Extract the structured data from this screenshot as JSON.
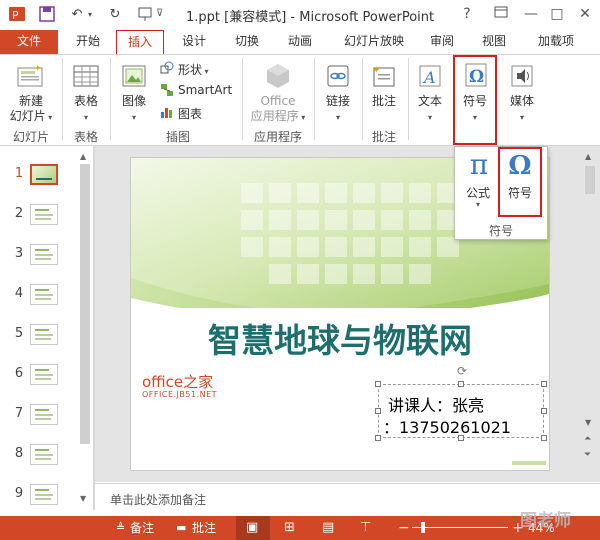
{
  "window": {
    "title": "1.ppt [兼容模式] - Microsoft PowerPoint",
    "help": "?",
    "minimize": "—",
    "maximize": "□",
    "close": "✕"
  },
  "tabs": [
    "文件",
    "开始",
    "插入",
    "设计",
    "切换",
    "动画",
    "幻灯片放映",
    "审阅",
    "视图",
    "加载项"
  ],
  "active_tab": "插入",
  "ribbon": {
    "new_slide": [
      "新建",
      "幻灯片"
    ],
    "table": "表格",
    "image": "图像",
    "shapes": "形状",
    "smartart": "SmartArt",
    "chart": "图表",
    "office_apps": [
      "Office",
      "应用程序"
    ],
    "link": "链接",
    "comment": "批注",
    "text": "文本",
    "symbols": "符号",
    "media": "媒体",
    "groups": {
      "slides": "幻灯片",
      "tables": "表格",
      "illustrations": "插图",
      "apps": "应用程序",
      "comments": "批注"
    }
  },
  "dropdown": {
    "equation": "公式",
    "symbol": "符号",
    "group_title": "符号"
  },
  "slides": {
    "numbers": [
      "1",
      "2",
      "3",
      "4",
      "5",
      "6",
      "7",
      "8",
      "9"
    ],
    "current": "1"
  },
  "slide": {
    "title": "智慧地球与物联网",
    "watermark_main": "office之家",
    "watermark_sub": "OFFICE.JB51.NET",
    "lecturer_line1": "讲课人：张亮",
    "lecturer_line2": "：13750261021"
  },
  "notes_placeholder": "单击此处添加备注",
  "status": {
    "notes": "备注",
    "comments": "批注",
    "zoom": "44%"
  },
  "watermark_corner": "图老师",
  "colors": {
    "accent": "#d24726",
    "highlight_box": "#d42020",
    "title_text": "#1e6e6e",
    "green": "#8cc24a"
  }
}
